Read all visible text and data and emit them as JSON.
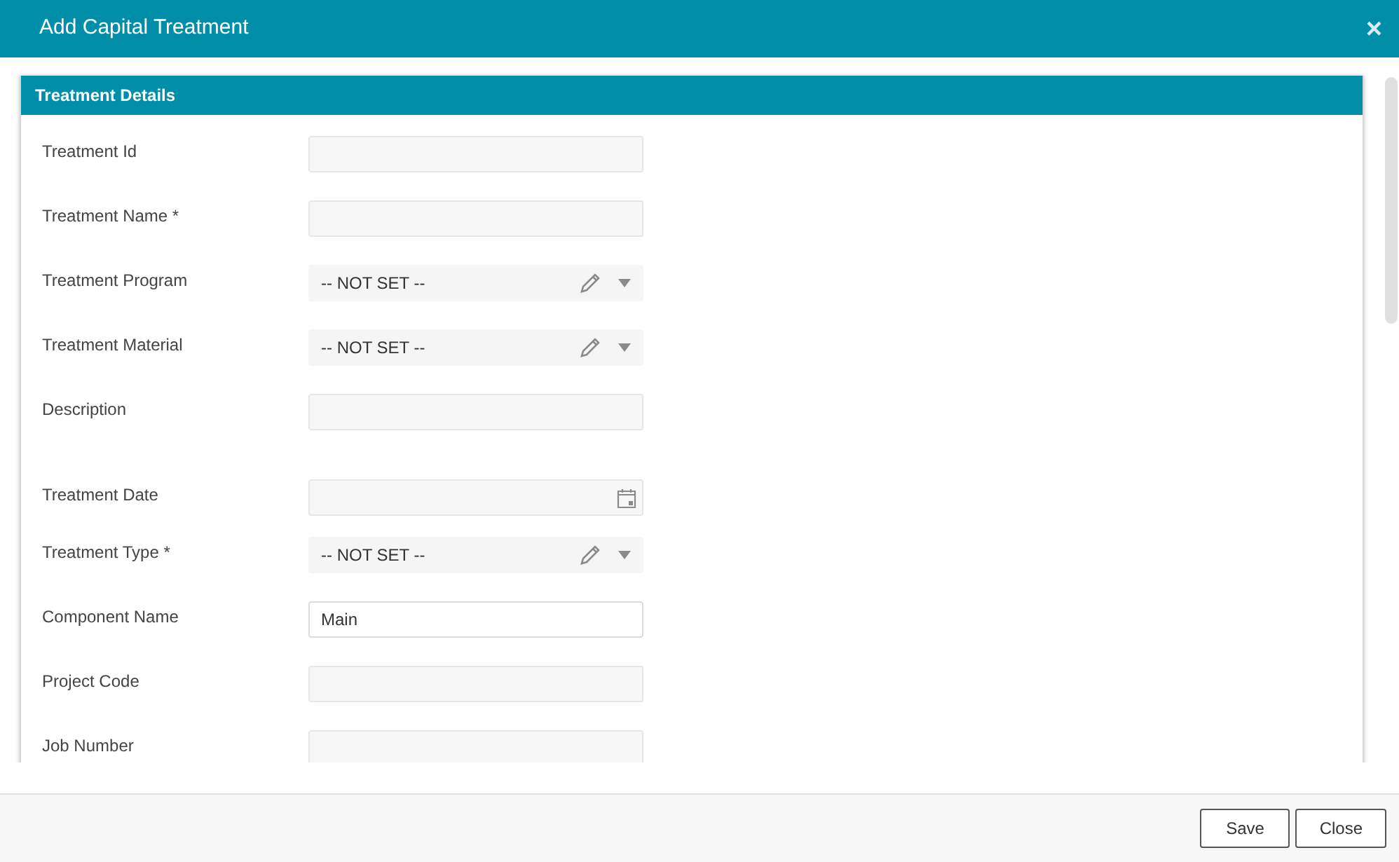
{
  "dialog": {
    "title": "Add Capital Treatment",
    "close_glyph": "×"
  },
  "panel": {
    "title": "Treatment Details"
  },
  "fields": [
    {
      "label": "Treatment Id",
      "kind": "text"
    },
    {
      "label": "Treatment Name *",
      "kind": "text"
    },
    {
      "label": "Treatment Program",
      "kind": "select",
      "value": "-- NOT SET --"
    },
    {
      "label": "Treatment Material",
      "kind": "select",
      "value": "-- NOT SET --"
    },
    {
      "label": "Description",
      "kind": "textarea"
    },
    {
      "label": "Treatment Date",
      "kind": "date"
    },
    {
      "label": "Treatment Type *",
      "kind": "select",
      "value": "-- NOT SET --"
    },
    {
      "label": "Component Name",
      "kind": "text",
      "value": "Main"
    },
    {
      "label": "Project Code",
      "kind": "text"
    },
    {
      "label": "Job Number",
      "kind": "text"
    }
  ],
  "buttons": [
    "Save",
    "Close"
  ]
}
